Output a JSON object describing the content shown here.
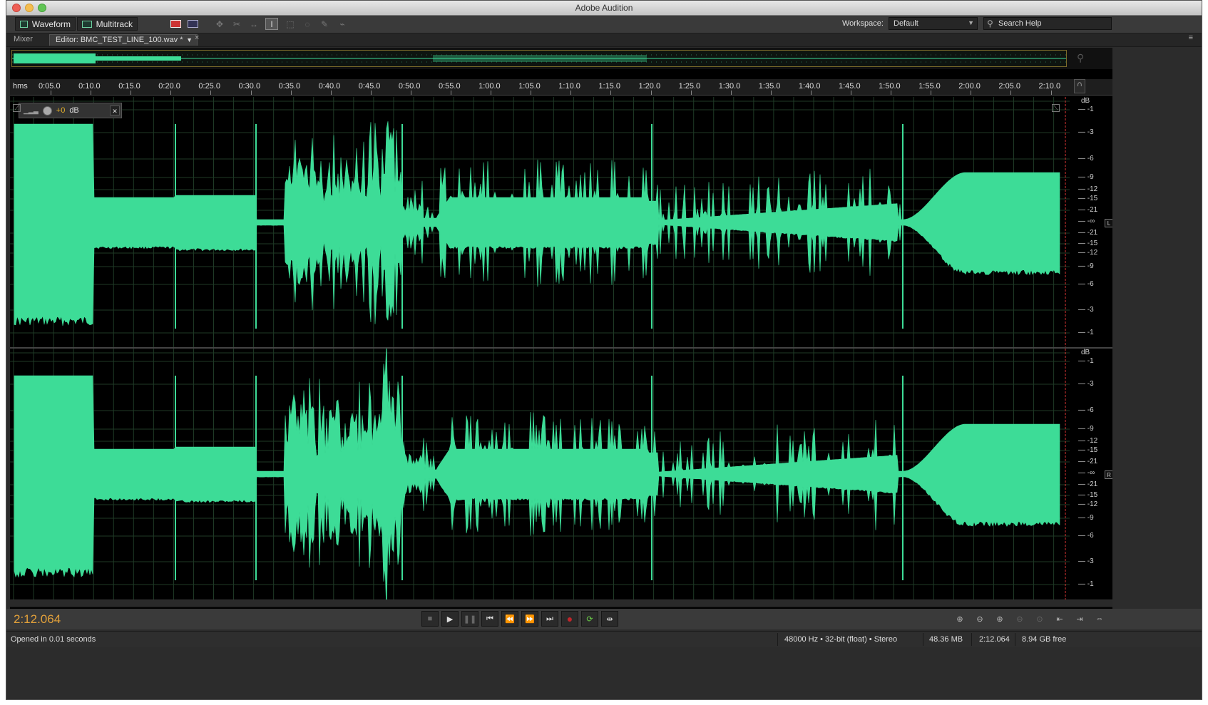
{
  "window": {
    "title": "Adobe Audition"
  },
  "toolbar": {
    "waveform_label": "Waveform",
    "multitrack_label": "Multitrack",
    "workspace_label": "Workspace:",
    "workspace_value": "Default",
    "search_placeholder": "Search Help"
  },
  "tabs": {
    "mixer_label": "Mixer",
    "editor_label": "Editor: BMC_TEST_LINE_100.wav *"
  },
  "ruler": {
    "unit_label": "hms",
    "ticks": [
      "0:05.0",
      "0:10.0",
      "0:15.0",
      "0:20.0",
      "0:25.0",
      "0:30.0",
      "0:35.0",
      "0:40.0",
      "0:45.0",
      "0:50.0",
      "0:55.0",
      "1:00.0",
      "1:05.0",
      "1:10.0",
      "1:15.0",
      "1:20.0",
      "1:25.0",
      "1:30.0",
      "1:35.0",
      "1:40.0",
      "1:45.0",
      "1:50.0",
      "1:55.0",
      "2:00.0",
      "2:05.0",
      "2:10.0"
    ]
  },
  "hud": {
    "volume_value": "+0",
    "volume_unit": "dB"
  },
  "channels": [
    {
      "label": "L",
      "db_labels": [
        "dB",
        "-1",
        "-3",
        "-6",
        "-9",
        "-12",
        "-15",
        "-21",
        "-∞",
        "-21",
        "-15",
        "-12",
        "-9",
        "-6",
        "-3",
        "-1"
      ]
    },
    {
      "label": "R",
      "db_labels": [
        "dB",
        "-1",
        "-3",
        "-6",
        "-9",
        "-12",
        "-15",
        "-21",
        "-∞",
        "-21",
        "-15",
        "-12",
        "-9",
        "-6",
        "-3",
        "-1"
      ]
    }
  ],
  "waveform": {
    "color": "#3ddc97"
  },
  "transport": {
    "timecode": "2:12.064"
  },
  "status": {
    "message": "Opened in 0.01 seconds",
    "format": "48000 Hz • 32-bit (float) • Stereo",
    "file_size": "48.36 MB",
    "duration": "2:12.064",
    "free_space": "8.94 GB free"
  }
}
